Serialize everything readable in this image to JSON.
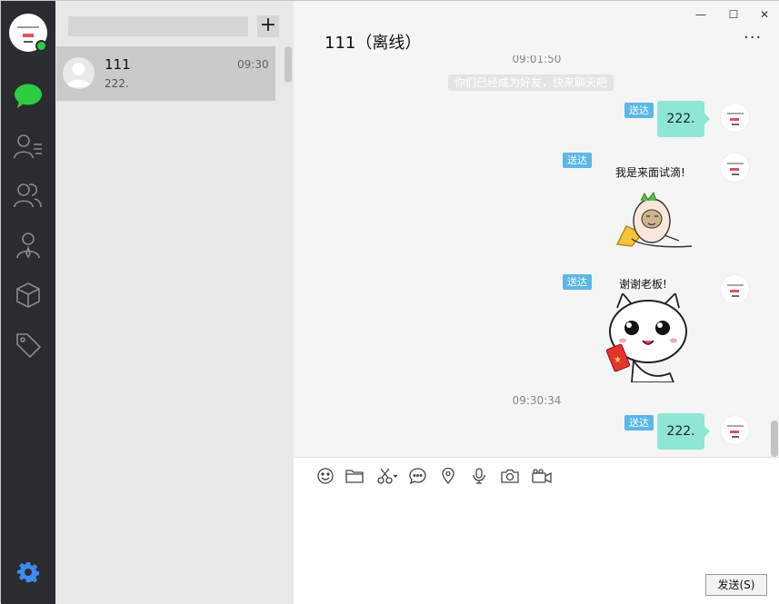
{
  "window": {
    "minimize_label": "—",
    "maximize_label": "☐",
    "close_label": "✕"
  },
  "nav": {
    "items": [
      {
        "name": "chat",
        "icon": "chat-bubble-icon",
        "active": true,
        "color": "#2ecc40"
      },
      {
        "name": "contacts",
        "icon": "contacts-list-icon"
      },
      {
        "name": "groups",
        "icon": "group-icon"
      },
      {
        "name": "organization",
        "icon": "person-tie-icon"
      },
      {
        "name": "apps",
        "icon": "cube-icon"
      },
      {
        "name": "tags",
        "icon": "tag-icon"
      }
    ],
    "settings_icon": "gear-icon",
    "settings_color": "#3b8cf2"
  },
  "list": {
    "search_placeholder": "",
    "add_label": "+",
    "conversations": [
      {
        "name": "111",
        "time": "09:30",
        "preview": "222."
      }
    ]
  },
  "chat": {
    "title": "111（离线）",
    "more_label": "···",
    "messages_top_time": "09:01:50",
    "system_notice": "你们已经成为好友，快来聊天吧",
    "messages": [
      {
        "type": "text",
        "text": "222.",
        "status": "送达"
      },
      {
        "type": "sticker",
        "caption": "我是来面试滴!",
        "status": "送达"
      },
      {
        "type": "sticker",
        "caption": "谢谢老板!",
        "status": "送达"
      }
    ],
    "mid_time": "09:30:34",
    "last_message": {
      "type": "text",
      "text": "222.",
      "status": "送达"
    },
    "bubble_color": "#8ee6d5",
    "status_color": "#5ab7e6"
  },
  "input": {
    "tools": [
      "emoji-icon",
      "folder-icon",
      "scissors-icon",
      "comment-icon",
      "location-icon",
      "microphone-icon",
      "camera-icon",
      "video-icon"
    ],
    "send_label": "发送(S)"
  }
}
